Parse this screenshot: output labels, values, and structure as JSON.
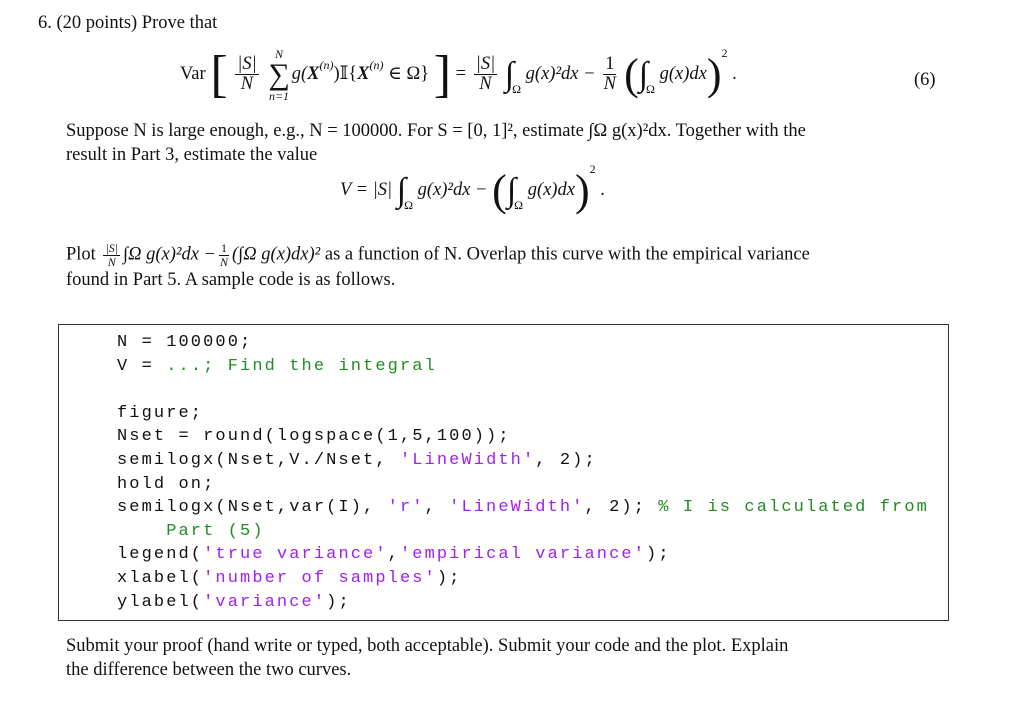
{
  "problem": {
    "number": "6.",
    "header": "(20 points) Prove that",
    "eq6": {
      "var": "Var",
      "abs_s": "|S|",
      "n": "N",
      "sum_upper": "N",
      "sum_lower": "n=1",
      "summand_g": "g(",
      "X": "X",
      "sup_n": "(n)",
      "indicator": ")𝕀{",
      "in_omega": " ∈ Ω}",
      "equals": "=",
      "omega": "Ω",
      "g_sq_dx": "g(x)²dx −",
      "one": "1",
      "g_dx": "g(x)dx",
      "two": "2",
      "period": ".",
      "label": "(6)"
    },
    "para1_line1": "Suppose N is large enough, e.g., N = 100000. For S = [0, 1]², estimate ∫Ω g(x)²dx. Together with the",
    "para1_line2": "result in Part 3, estimate the value",
    "eqV": {
      "lhs": "V = |S|",
      "omega": "Ω",
      "g_sq_dx": "g(x)²dx −",
      "g_dx": "g(x)dx",
      "two": "2",
      "period": "."
    },
    "para2_line1_pre": "Plot",
    "para2_frac_num": "|S|",
    "para2_frac_den": "N",
    "para2_expr": "∫Ω g(x)²dx −",
    "para2_frac2_num": "1",
    "para2_frac2_den": "N",
    "para2_expr2": "(∫Ω g(x)dx)²",
    "para2_line1_post": "as a function of N. Overlap this curve with the empirical variance",
    "para2_line2": "found in Part 5. A sample code is as follows.",
    "code_lines": [
      [
        {
          "t": "N = 100000;",
          "k": "plain"
        }
      ],
      [
        {
          "t": "V = ",
          "k": "plain"
        },
        {
          "t": "...; Find the integral",
          "k": "com"
        }
      ],
      [],
      [
        {
          "t": "figure;",
          "k": "plain"
        }
      ],
      [
        {
          "t": "Nset = round(logspace(1,5,100));",
          "k": "plain"
        }
      ],
      [
        {
          "t": "semilogx(Nset,V./Nset, ",
          "k": "plain"
        },
        {
          "t": "'LineWidth'",
          "k": "str"
        },
        {
          "t": ", 2);",
          "k": "plain"
        }
      ],
      [
        {
          "t": "hold on;",
          "k": "plain"
        }
      ],
      [
        {
          "t": "semilogx(Nset,var(I), ",
          "k": "plain"
        },
        {
          "t": "'r'",
          "k": "str"
        },
        {
          "t": ", ",
          "k": "plain"
        },
        {
          "t": "'LineWidth'",
          "k": "str"
        },
        {
          "t": ", 2); ",
          "k": "plain"
        },
        {
          "t": "% I is calculated from",
          "k": "com"
        }
      ],
      [
        {
          "t": "    Part (5)",
          "k": "com"
        }
      ],
      [
        {
          "t": "legend(",
          "k": "plain"
        },
        {
          "t": "'true variance'",
          "k": "str"
        },
        {
          "t": ",",
          "k": "plain"
        },
        {
          "t": "'empirical variance'",
          "k": "str"
        },
        {
          "t": ");",
          "k": "plain"
        }
      ],
      [
        {
          "t": "xlabel(",
          "k": "plain"
        },
        {
          "t": "'number of samples'",
          "k": "str"
        },
        {
          "t": ");",
          "k": "plain"
        }
      ],
      [
        {
          "t": "ylabel(",
          "k": "plain"
        },
        {
          "t": "'variance'",
          "k": "str"
        },
        {
          "t": ");",
          "k": "plain"
        }
      ]
    ],
    "para3_line1": "Submit your proof (hand write or typed, both acceptable). Submit your code and the plot. Explain",
    "para3_line2": "the difference between the two curves.",
    "colors": {
      "string": "#a020f0",
      "comment": "#228b22",
      "text": "#111111"
    }
  }
}
